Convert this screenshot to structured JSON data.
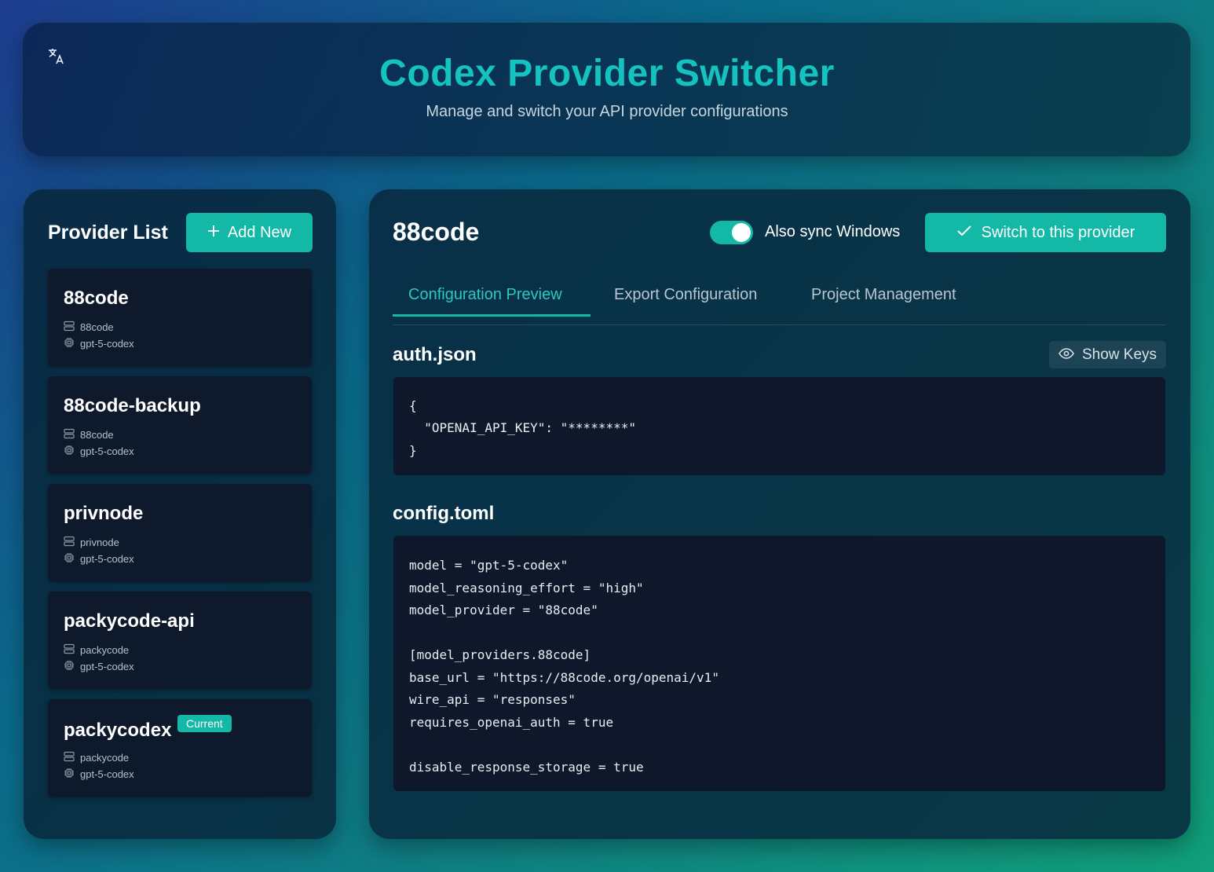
{
  "header": {
    "title": "Codex Provider Switcher",
    "subtitle": "Manage and switch your API provider configurations",
    "language_icon": "translate-icon"
  },
  "sidebar": {
    "title": "Provider List",
    "add_label": "Add New",
    "providers": [
      {
        "name": "88code",
        "base": "88code",
        "model": "gpt-5-codex",
        "current": false
      },
      {
        "name": "88code-backup",
        "base": "88code",
        "model": "gpt-5-codex",
        "current": false
      },
      {
        "name": "privnode",
        "base": "privnode",
        "model": "gpt-5-codex",
        "current": false
      },
      {
        "name": "packycode-api",
        "base": "packycode",
        "model": "gpt-5-codex",
        "current": false
      },
      {
        "name": "packycodex",
        "base": "packycode",
        "model": "gpt-5-codex",
        "current": true
      }
    ],
    "current_badge": "Current"
  },
  "main": {
    "provider_title": "88code",
    "sync_label": "Also sync Windows",
    "sync_enabled": true,
    "switch_label": "Switch to this provider",
    "tabs": [
      {
        "label": "Configuration Preview",
        "active": true
      },
      {
        "label": "Export Configuration",
        "active": false
      },
      {
        "label": "Project Management",
        "active": false
      }
    ],
    "auth": {
      "title": "auth.json",
      "show_keys_label": "Show Keys",
      "lines": [
        "{",
        "  \"OPENAI_API_KEY\": \"********\"",
        "}"
      ]
    },
    "config": {
      "title": "config.toml",
      "lines": [
        "model = \"gpt-5-codex\"",
        "model_reasoning_effort = \"high\"",
        "model_provider = \"88code\"",
        "",
        "[model_providers.88code]",
        "base_url = \"https://88code.org/openai/v1\"",
        "wire_api = \"responses\"",
        "requires_openai_auth = true",
        "",
        "disable_response_storage = true"
      ]
    }
  },
  "colors": {
    "accent": "#14b8a6",
    "title": "#14c3c0",
    "code_bg": "#0f172a"
  }
}
